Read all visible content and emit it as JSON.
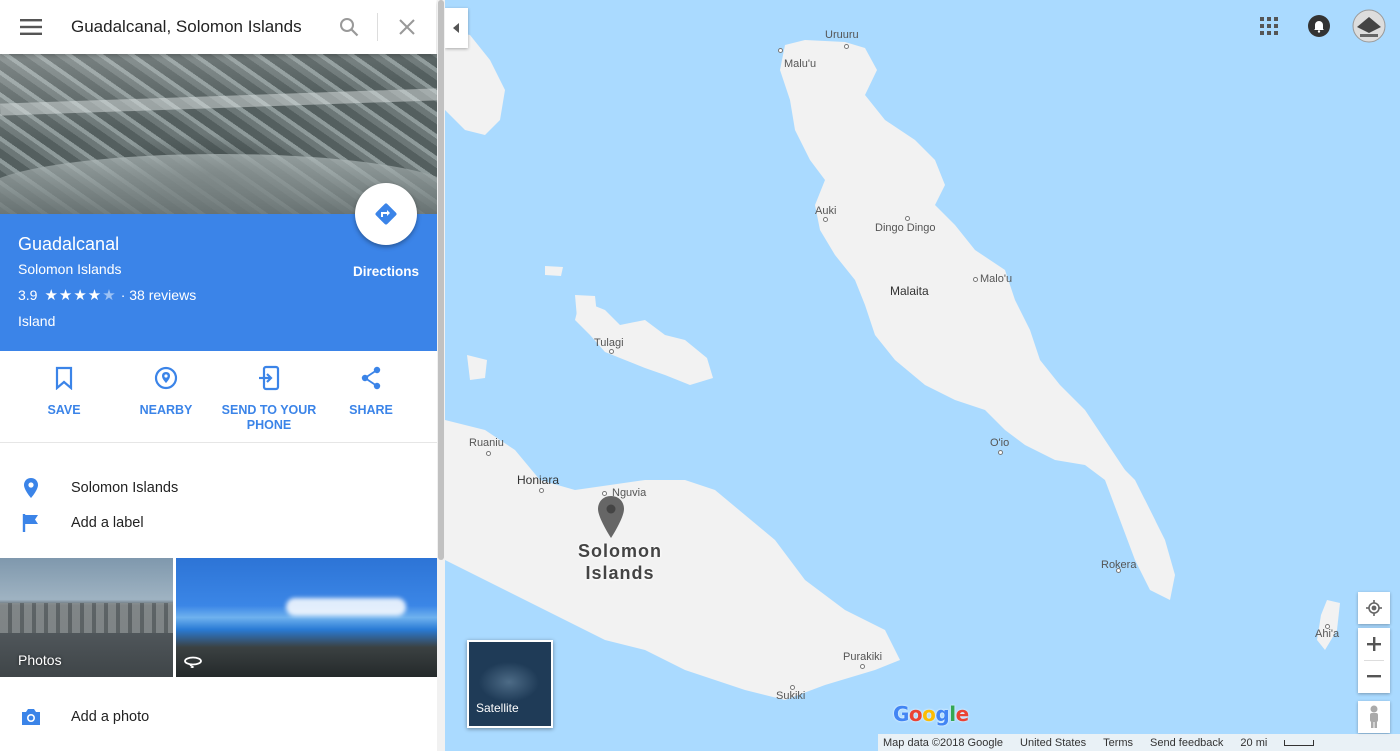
{
  "search": {
    "value": "Guadalcanal, Solomon Islands",
    "icon": "search-icon",
    "clear_icon": "close-icon",
    "menu_icon": "hamburger-menu-icon"
  },
  "place": {
    "title": "Guadalcanal",
    "subtitle": "Solomon Islands",
    "rating": "3.9",
    "rating_value": 3.9,
    "stars_full": "★★★★",
    "stars_empty": "★",
    "reviews": "· 38 reviews",
    "category": "Island",
    "directions_label": "Directions"
  },
  "actions": [
    {
      "label": "SAVE",
      "icon": "bookmark-icon"
    },
    {
      "label": "NEARBY",
      "icon": "nearby-icon"
    },
    {
      "label": "SEND TO YOUR PHONE",
      "icon": "send-to-phone-icon"
    },
    {
      "label": "SHARE",
      "icon": "share-icon"
    }
  ],
  "info": {
    "address": "Solomon Islands",
    "add_label": "Add a label",
    "add_photo": "Add a photo"
  },
  "photos": {
    "label": "Photos"
  },
  "map": {
    "country_line1": "Solomon",
    "country_line2": "Islands",
    "places": {
      "uruuru": "Uruuru",
      "maluu": "Malu'u",
      "auki": "Auki",
      "dingo": "Dingo Dingo",
      "malaita": "Malaita",
      "malou": "Malo'u",
      "tulagi": "Tulagi",
      "oio": "O'io",
      "ruaniu": "Ruaniu",
      "honiara": "Honiara",
      "nguvia": "Nguvia",
      "rokera": "Rokera",
      "ahia": "Ahi'a",
      "purakiki": "Purakiki",
      "sukiki": "Sukiki"
    },
    "satellite_label": "Satellite",
    "logo": {
      "letters": [
        "G",
        "o",
        "o",
        "g",
        "l",
        "e"
      ]
    },
    "footer": {
      "map_data": "Map data ©2018 Google",
      "region": "United States",
      "terms": "Terms",
      "feedback": "Send feedback",
      "scale": "20 mi"
    }
  },
  "colors": {
    "accent": "#3b84e8",
    "water": "#aadaff",
    "land": "#f2f2f2"
  }
}
